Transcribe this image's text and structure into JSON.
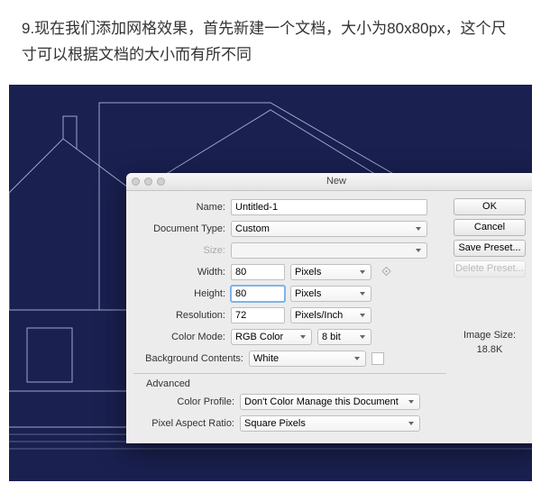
{
  "instruction": "9.现在我们添加网格效果，首先新建一个文档，大小为80x80px，这个尺寸可以根据文档的大小而有所不同",
  "dialog": {
    "title": "New",
    "labels": {
      "name": "Name:",
      "docType": "Document Type:",
      "size": "Size:",
      "width": "Width:",
      "height": "Height:",
      "resolution": "Resolution:",
      "colorMode": "Color Mode:",
      "bgContents": "Background Contents:",
      "advanced": "Advanced",
      "colorProfile": "Color Profile:",
      "pixelAspect": "Pixel Aspect Ratio:"
    },
    "values": {
      "name": "Untitled-1",
      "docType": "Custom",
      "size": "",
      "width": "80",
      "widthUnit": "Pixels",
      "height": "80",
      "heightUnit": "Pixels",
      "resolution": "72",
      "resolutionUnit": "Pixels/Inch",
      "colorMode": "RGB Color",
      "bitDepth": "8 bit",
      "bgContents": "White",
      "colorProfile": "Don't Color Manage this Document",
      "pixelAspect": "Square Pixels"
    },
    "buttons": {
      "ok": "OK",
      "cancel": "Cancel",
      "savePreset": "Save Preset...",
      "deletePreset": "Delete Preset..."
    },
    "imageSize": {
      "label": "Image Size:",
      "value": "18.8K"
    }
  }
}
